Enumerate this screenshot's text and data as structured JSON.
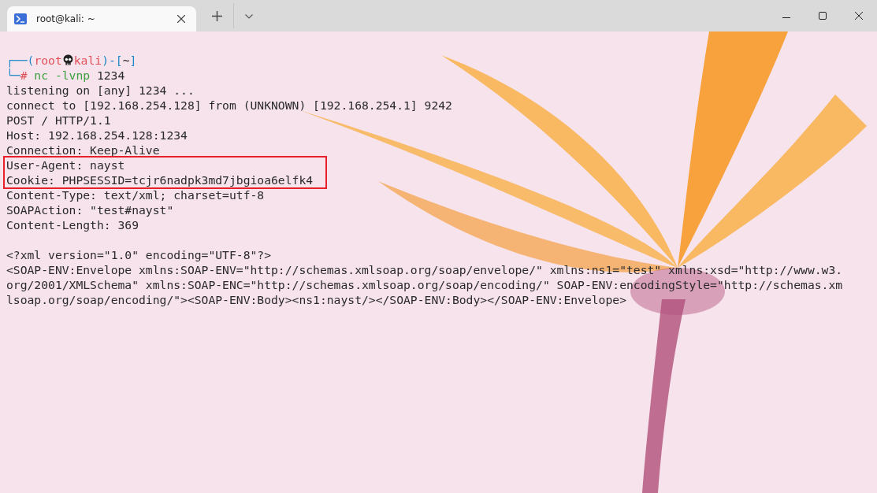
{
  "window": {
    "tab": {
      "title": "root@kali: ~",
      "selected": true
    }
  },
  "prompt": [
    {
      "kind": "frame",
      "text": "┌──("
    },
    {
      "kind": "user",
      "text": "root"
    },
    {
      "kind": "skull"
    },
    {
      "kind": "user",
      "text": "kali"
    },
    {
      "kind": "frame",
      "text": ")-["
    },
    {
      "kind": "plain",
      "text": "~"
    },
    {
      "kind": "frame",
      "text": "]"
    }
  ],
  "command": [
    {
      "kind": "frame",
      "text": "└─"
    },
    {
      "kind": "user",
      "text": "#"
    },
    {
      "kind": "command",
      "text": "nc"
    },
    {
      "kind": "command",
      "text": "-lvnp"
    },
    {
      "kind": "plain",
      "text": "1234"
    }
  ],
  "output": [
    {
      "text": "listening on [any] 1234 ...",
      "highlighted": false
    },
    {
      "text": "connect to [192.168.254.128] from (UNKNOWN) [192.168.254.1] 9242",
      "highlighted": false
    },
    {
      "text": "POST / HTTP/1.1",
      "highlighted": false
    },
    {
      "text": "Host: 192.168.254.128:1234",
      "highlighted": false
    },
    {
      "text": "Connection: Keep-Alive",
      "highlighted": false
    },
    {
      "text": "User-Agent: nayst",
      "highlighted": true
    },
    {
      "text": "Cookie: PHPSESSID=tcjr6nadpk3md7jbgioa6elfk4",
      "highlighted": true
    },
    {
      "text": "Content-Type: text/xml; charset=utf-8",
      "highlighted": false
    },
    {
      "text": "SOAPAction: \"test#nayst\"",
      "highlighted": false
    },
    {
      "text": "Content-Length: 369",
      "highlighted": false
    }
  ],
  "xml": [
    {
      "text": "<?xml version=\"1.0\" encoding=\"UTF-8\"?>",
      "highlighted": false
    },
    {
      "text": "<SOAP-ENV:Envelope xmlns:SOAP-ENV=\"http://schemas.xmlsoap.org/soap/envelope/\" xmlns:ns1=\"test\" xmlns:xsd=\"http://www.w3.",
      "highlighted": false
    },
    {
      "text": "org/2001/XMLSchema\" xmlns:SOAP-ENC=\"http://schemas.xmlsoap.org/soap/encoding/\" SOAP-ENV:encodingStyle=\"http://schemas.xm",
      "highlighted": false
    },
    {
      "text": "lsoap.org/soap/encoding/\"><SOAP-ENV:Body><ns1:nayst/></SOAP-ENV:Body></SOAP-ENV:Envelope>",
      "highlighted": false
    }
  ]
}
